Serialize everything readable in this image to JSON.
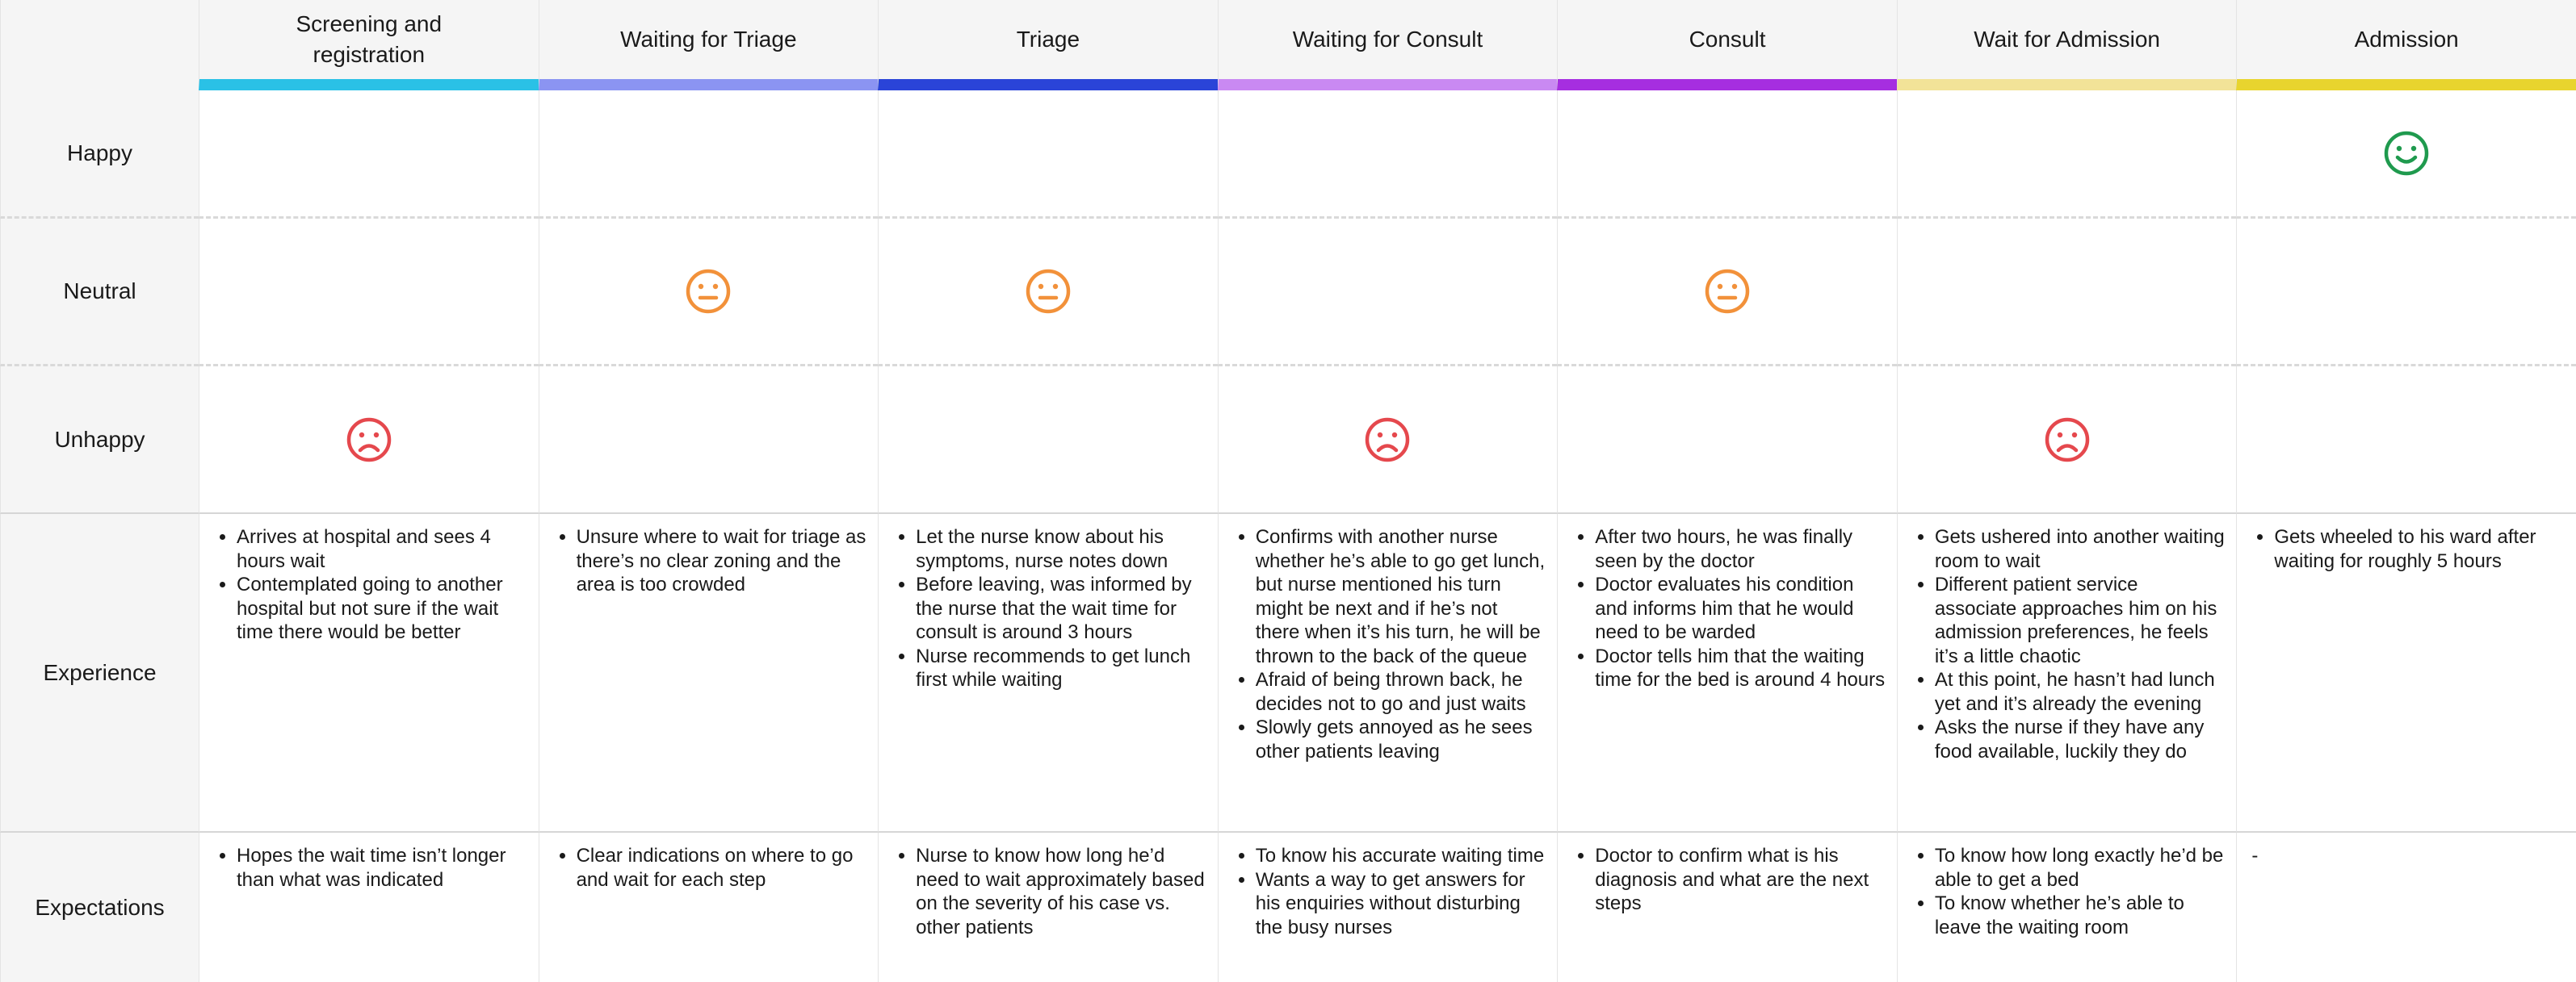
{
  "row_labels": {
    "happy": "Happy",
    "neutral": "Neutral",
    "unhappy": "Unhappy",
    "experience": "Experience",
    "expectations": "Expectations"
  },
  "stages": [
    {
      "title": "Screening and registration",
      "color": "#2ac1e6",
      "emotion": "unhappy",
      "experience": [
        "Arrives at hospital and sees 4 hours wait",
        "Contemplated going to another hospital but not sure if the wait time there would be better"
      ],
      "expectations": [
        "Hopes the wait time isn’t longer than what was indicated"
      ]
    },
    {
      "title": "Waiting for Triage",
      "color": "#8b94f2",
      "emotion": "neutral",
      "experience": [
        "Unsure where to wait for triage as there’s no clear zoning and the area is too crowded"
      ],
      "expectations": [
        "Clear indications on where to go and wait for each step"
      ]
    },
    {
      "title": "Triage",
      "color": "#2a44d8",
      "emotion": "neutral",
      "experience": [
        "Let the nurse know about his symptoms, nurse notes down",
        "Before leaving, was informed by the nurse that the wait time for consult is around 3 hours",
        "Nurse recommends to get lunch first while waiting"
      ],
      "expectations": [
        "Nurse to know how long he’d need to wait approximately based on the severity of his case vs. other patients"
      ]
    },
    {
      "title": "Waiting for Consult",
      "color": "#c989f2",
      "emotion": "unhappy",
      "experience": [
        "Confirms with another nurse whether he’s able to go get lunch, but nurse mentioned his turn might be next and if he’s not there when it’s his turn, he will be thrown to the back of the queue",
        "Afraid of being thrown back, he decides not to go and just waits",
        "Slowly gets annoyed as he sees other patients leaving"
      ],
      "expectations": [
        "To know his accurate waiting time",
        "Wants a way to get answers for his enquiries without disturbing the busy nurses"
      ]
    },
    {
      "title": "Consult",
      "color": "#a62ee0",
      "emotion": "neutral",
      "experience": [
        "After two hours, he was finally seen by the doctor",
        "Doctor evaluates his condition and informs him that he would need to be warded",
        "Doctor tells him that the waiting time for the bed is around 4 hours"
      ],
      "expectations": [
        "Doctor to confirm what is his diagnosis and what are the next steps"
      ]
    },
    {
      "title": "Wait for Admission",
      "color": "#f2e398",
      "emotion": "unhappy",
      "experience": [
        "Gets ushered into another waiting room to wait",
        "Different patient service associate approaches him on his admission preferences, he feels it’s a little chaotic",
        "At this point, he hasn’t had lunch yet and it’s already the evening",
        "Asks the nurse if they have any food available, luckily they do"
      ],
      "expectations": [
        "To know how long exactly he’d be able to get a bed",
        "To know whether he’s able to leave the waiting room"
      ]
    },
    {
      "title": "Admission",
      "color": "#e8d42e",
      "emotion": "happy",
      "experience": [
        "Gets wheeled to his ward after waiting for roughly 5 hours"
      ],
      "expectations_text": "-"
    }
  ],
  "emotion_colors": {
    "happy": "#1f9a4e",
    "neutral": "#f2913a",
    "unhappy": "#e5484d"
  },
  "emotion_icons": {
    "happy": "smiling-face-icon",
    "neutral": "neutral-face-icon",
    "unhappy": "frowning-face-icon"
  }
}
